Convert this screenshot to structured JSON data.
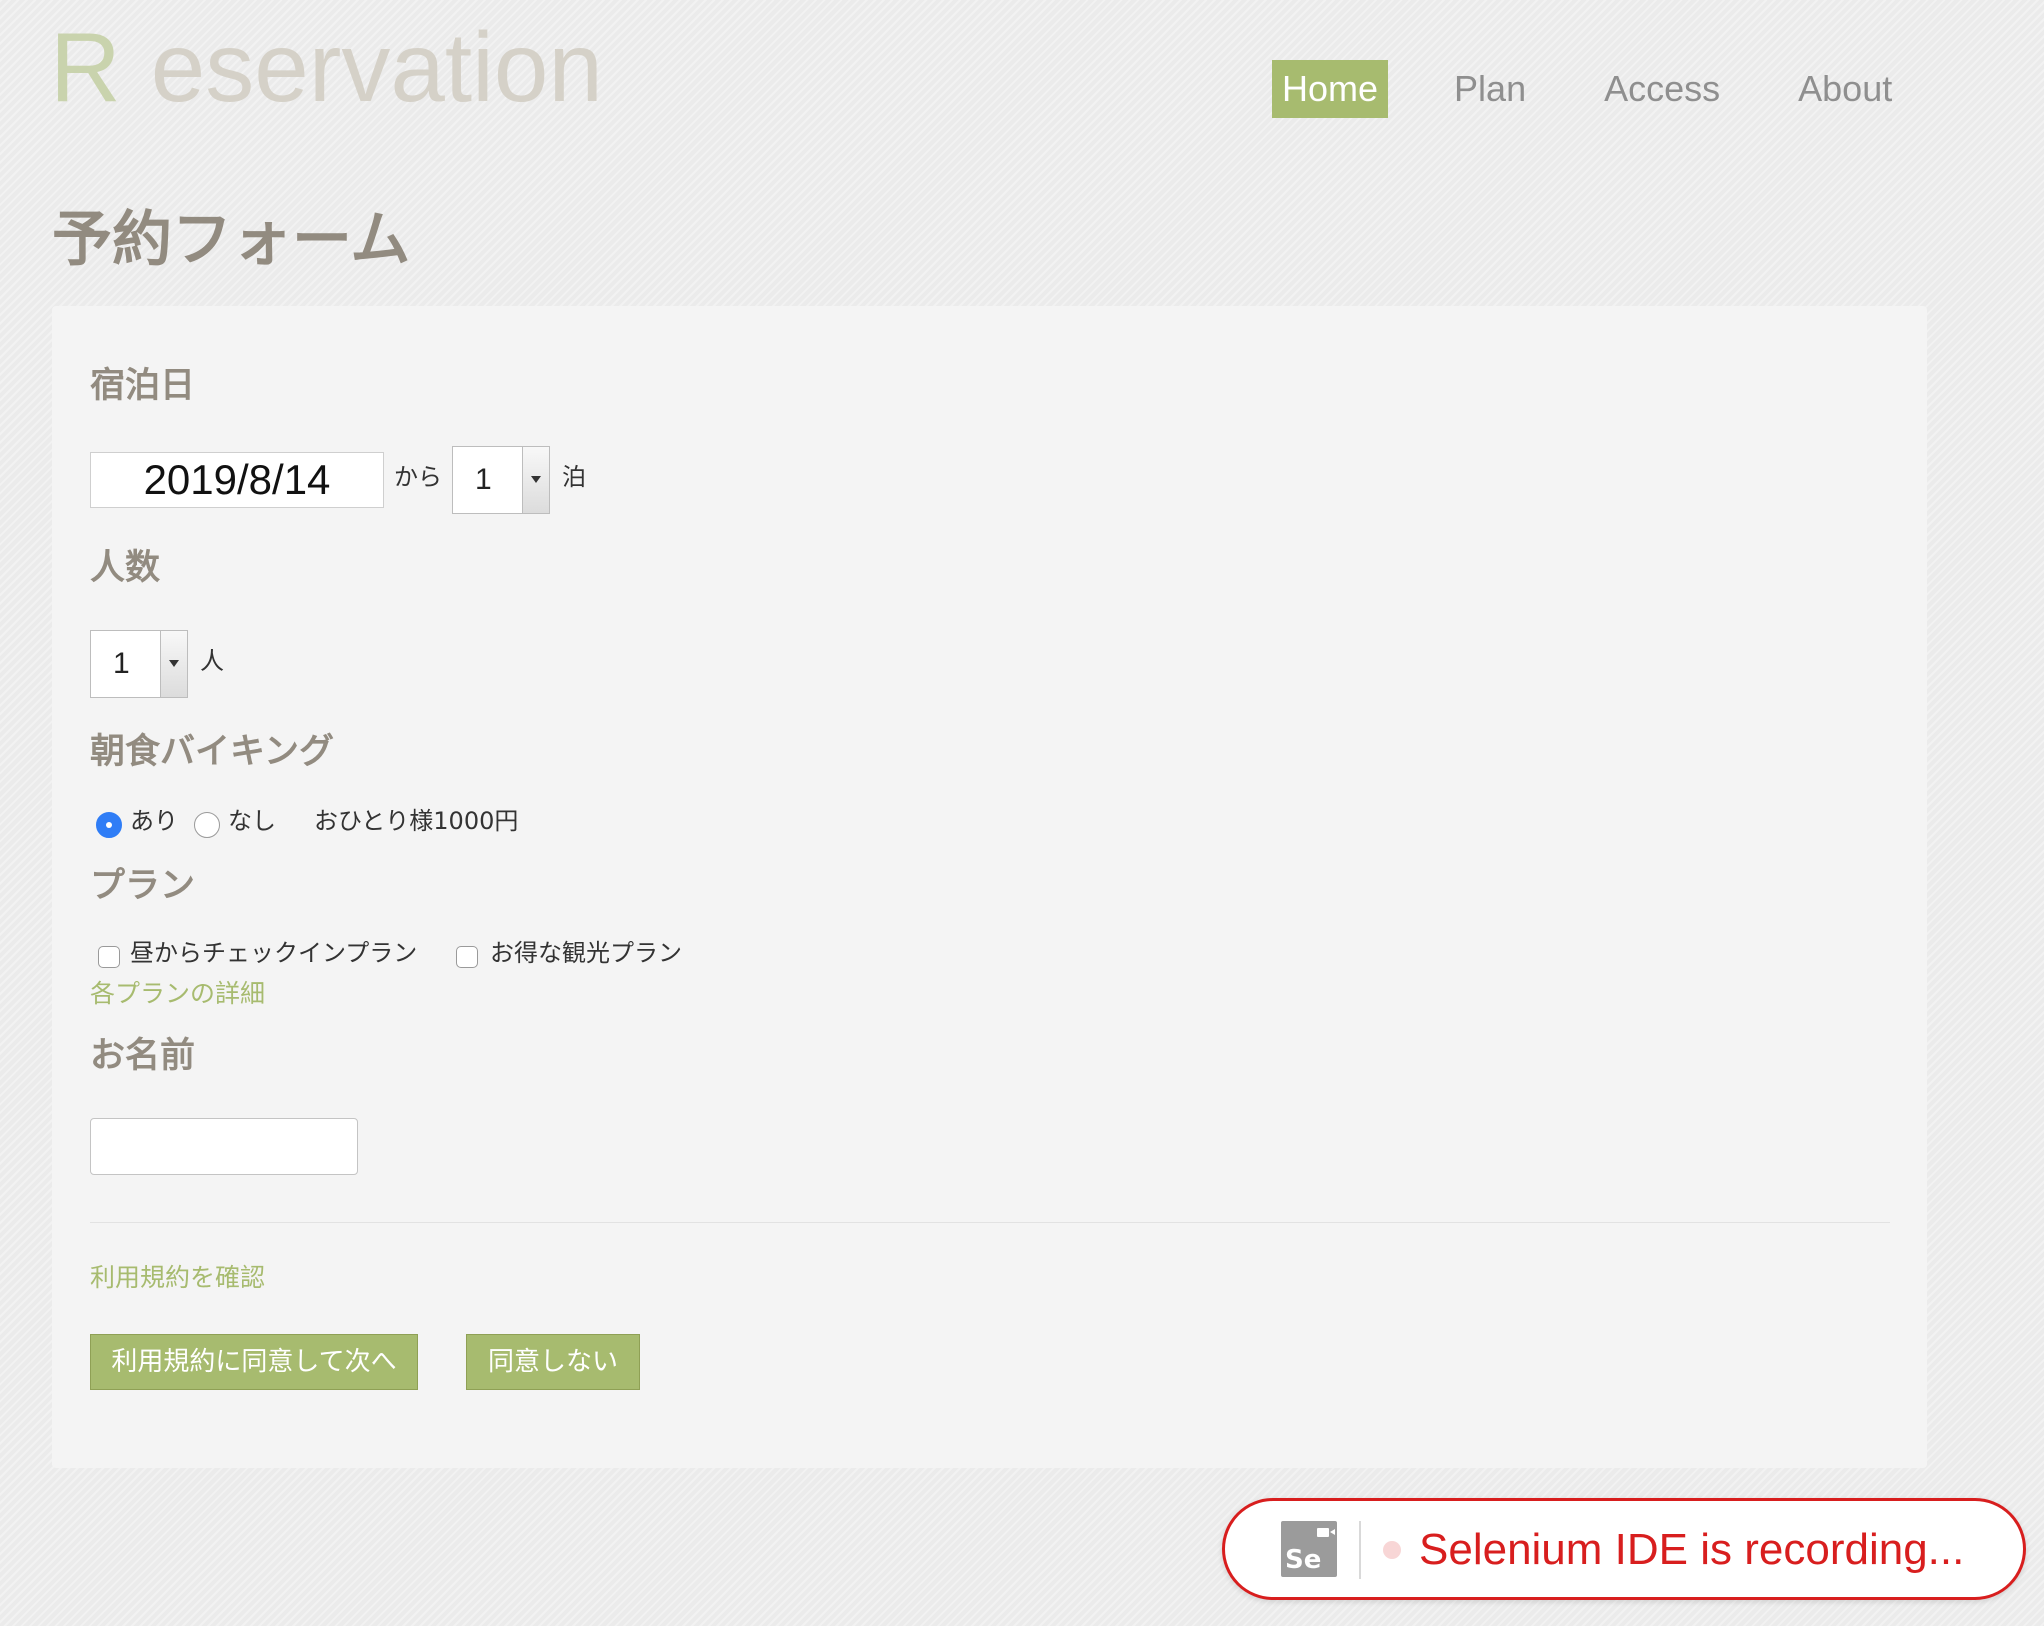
{
  "header": {
    "logo_initial": "R",
    "logo_rest": "eservation",
    "nav": {
      "home": "Home",
      "plan": "Plan",
      "access": "Access",
      "about": "About"
    }
  },
  "page_title": "予約フォーム",
  "form": {
    "stay_date": {
      "label": "宿泊日",
      "date_value": "2019/8/14",
      "from_text": "から",
      "nights_value": "1",
      "nights_unit": "泊"
    },
    "guests": {
      "label": "人数",
      "value": "1",
      "unit": "人"
    },
    "breakfast": {
      "label": "朝食バイキング",
      "option_yes": "あり",
      "option_no": "なし",
      "selected": "あり",
      "price_note": "おひとり様1000円"
    },
    "plans": {
      "label": "プラン",
      "option_early_checkin": "昼からチェックインプラン",
      "option_sightseeing": "お得な観光プラン",
      "details_link": "各プランの詳細"
    },
    "name": {
      "label": "お名前",
      "value": ""
    },
    "terms_link": "利用規約を確認",
    "agree_button": "利用規約に同意して次へ",
    "disagree_button": "同意しない"
  },
  "selenium": {
    "logo_text": "Se",
    "status_text": "Selenium IDE is recording..."
  },
  "colors": {
    "accent_green": "#a7bb6f",
    "heading_gray": "#928b80",
    "recording_red": "#d81e1e",
    "radio_blue": "#2f7df6"
  }
}
